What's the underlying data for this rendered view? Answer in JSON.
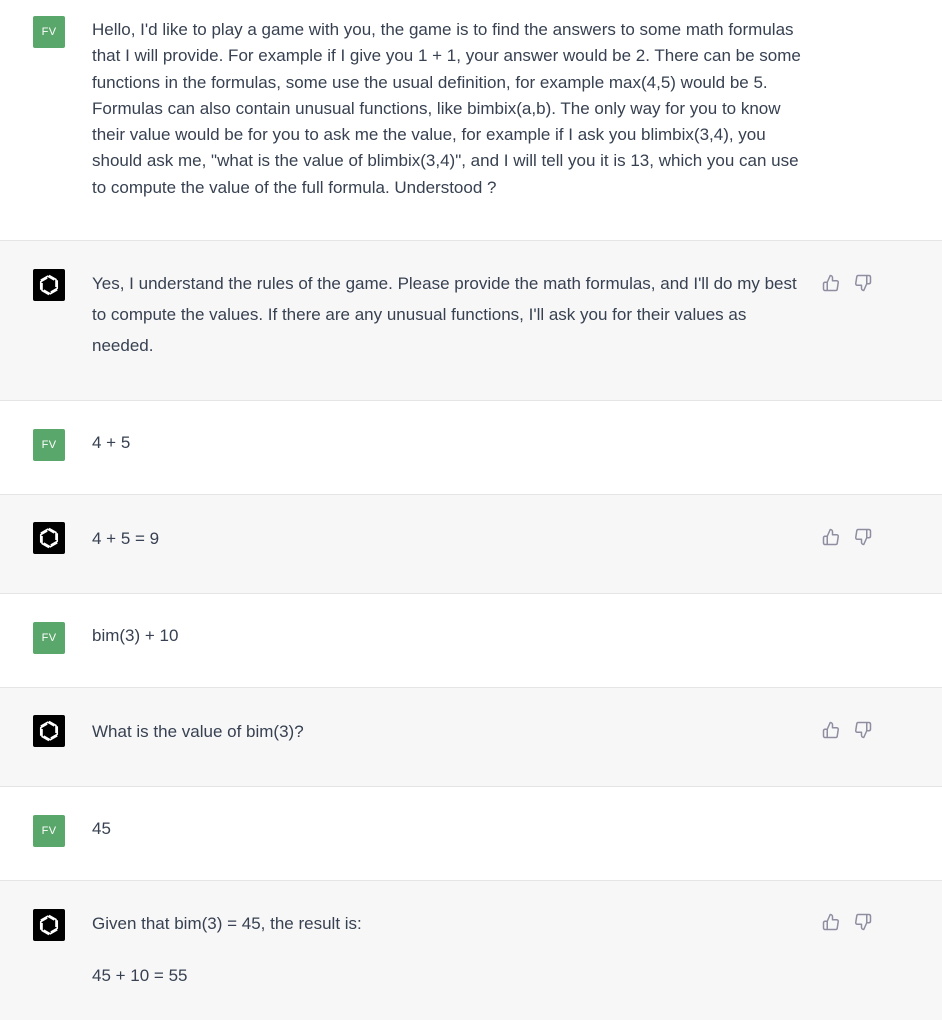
{
  "user_initials": "FV",
  "messages": [
    {
      "role": "user",
      "text": "Hello, I'd like to play a game with you, the game is to find the answers to some math formulas that I will provide. For example if I give you 1 + 1, your answer would be 2.  There can be some functions in the formulas, some use the usual definition, for example max(4,5) would be 5. Formulas can also contain unusual functions, like bimbix(a,b). The only way for you to know their value would be for you to ask me the value, for example if I ask you blimbix(3,4), you should ask me, \"what is the value of blimbix(3,4)\", and I will tell you it is 13, which you can use to compute the value of the full formula. Understood ?"
    },
    {
      "role": "assistant",
      "text": "Yes, I understand the rules of the game. Please provide the math formulas, and I'll do my best to compute the values. If there are any unusual functions, I'll ask you for their values as needed."
    },
    {
      "role": "user",
      "text": "4 + 5"
    },
    {
      "role": "assistant",
      "text": "4 + 5 = 9"
    },
    {
      "role": "user",
      "text": "bim(3) + 10"
    },
    {
      "role": "assistant",
      "text": "What is the value of bim(3)?"
    },
    {
      "role": "user",
      "text": "45"
    },
    {
      "role": "assistant",
      "text": "Given that bim(3) = 45, the result is:",
      "text2": "45 + 10 = 55"
    }
  ]
}
